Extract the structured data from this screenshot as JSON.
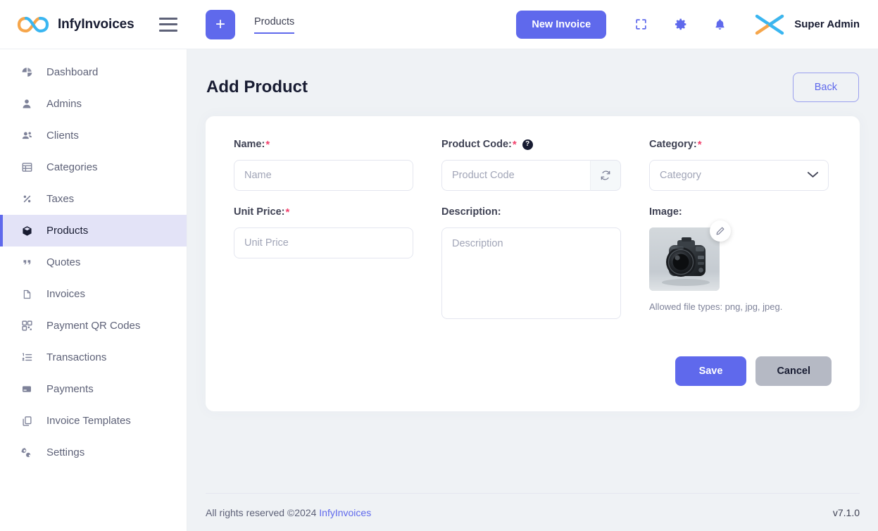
{
  "header": {
    "brand": "InfyInvoices",
    "logo_icon": "infinity-logo-icon",
    "menu_icon": "hamburger-menu-icon",
    "add_icon": "plus-icon",
    "breadcrumb": "Products",
    "new_invoice_label": "New Invoice",
    "fullscreen_icon": "fullscreen-icon",
    "settings_icon": "gear-icon",
    "notifications_icon": "bell-icon",
    "avatar_icon": "user-avatar-x-logo",
    "user_name": "Super Admin",
    "accent_color": "#5f69ec"
  },
  "sidebar": {
    "items": [
      {
        "label": "Dashboard",
        "icon": "pie-chart-icon",
        "active": false
      },
      {
        "label": "Admins",
        "icon": "user-icon",
        "active": false
      },
      {
        "label": "Clients",
        "icon": "users-group-icon",
        "active": false
      },
      {
        "label": "Categories",
        "icon": "table-list-icon",
        "active": false
      },
      {
        "label": "Taxes",
        "icon": "percent-icon",
        "active": false
      },
      {
        "label": "Products",
        "icon": "box-cube-icon",
        "active": true
      },
      {
        "label": "Quotes",
        "icon": "quote-marks-icon",
        "active": false
      },
      {
        "label": "Invoices",
        "icon": "document-icon",
        "active": false
      },
      {
        "label": "Payment QR Codes",
        "icon": "qr-code-icon",
        "active": false
      },
      {
        "label": "Transactions",
        "icon": "ordered-list-icon",
        "active": false
      },
      {
        "label": "Payments",
        "icon": "credit-card-icon",
        "active": false
      },
      {
        "label": "Invoice Templates",
        "icon": "copy-documents-icon",
        "active": false
      },
      {
        "label": "Settings",
        "icon": "gears-icon",
        "active": false
      }
    ],
    "active_bg": "#e3e3f7",
    "active_border": "#5f69ec"
  },
  "page": {
    "title": "Add Product",
    "back_label": "Back"
  },
  "form": {
    "name": {
      "label": "Name:",
      "required_mark": "*",
      "placeholder": "Name",
      "value": ""
    },
    "product_code": {
      "label": "Product Code:",
      "required_mark": "*",
      "help_icon": "question-mark-icon",
      "placeholder": "Product Code",
      "value": "",
      "regenerate_icon": "refresh-sync-icon"
    },
    "category": {
      "label": "Category:",
      "required_mark": "*",
      "placeholder": "Category",
      "selected": "Category",
      "chevron_icon": "chevron-down-icon"
    },
    "unit_price": {
      "label": "Unit Price:",
      "required_mark": "*",
      "placeholder": "Unit Price",
      "value": ""
    },
    "description": {
      "label": "Description:",
      "placeholder": "Description",
      "value": ""
    },
    "image": {
      "label": "Image:",
      "edit_icon": "pencil-edit-icon",
      "thumbnail_alt": "dslr-camera-photo",
      "allowed_text": "Allowed file types: png, jpg, jpeg."
    },
    "save_label": "Save",
    "cancel_label": "Cancel"
  },
  "footer": {
    "copyright": "All rights reserved ©2024",
    "brand_link": "InfyInvoices",
    "version": "v7.1.0"
  }
}
